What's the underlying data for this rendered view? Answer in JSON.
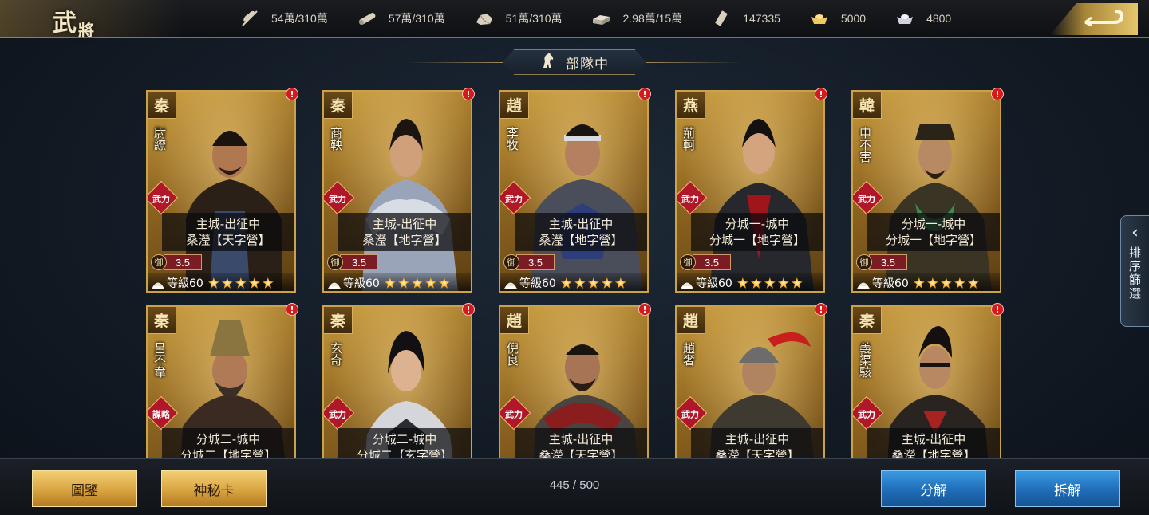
{
  "header": {
    "title_big": "武",
    "title_small": "將",
    "resources": [
      {
        "icon": "grain-icon",
        "value": "54萬/310萬"
      },
      {
        "icon": "wood-icon",
        "value": "57萬/310萬"
      },
      {
        "icon": "stone-icon",
        "value": "51萬/310萬"
      },
      {
        "icon": "iron-icon",
        "value": "2.98萬/15萬"
      },
      {
        "icon": "decree-icon",
        "value": "147335"
      },
      {
        "icon": "gold-ingot-icon",
        "value": "5000"
      },
      {
        "icon": "silver-ingot-icon",
        "value": "4800"
      }
    ]
  },
  "section": {
    "label": "部隊中"
  },
  "generals": [
    {
      "faction": "秦",
      "name": "尉繚",
      "role": "武力",
      "status1": "主城-出征中",
      "status2": "桑瀅【天字營】",
      "defense_label": "御",
      "defense": "3.5",
      "level": "等級60",
      "stars": 5
    },
    {
      "faction": "秦",
      "name": "商鞅",
      "role": "武力",
      "status1": "主城-出征中",
      "status2": "桑瀅【地字營】",
      "defense_label": "御",
      "defense": "3.5",
      "level": "等級60",
      "stars": 5
    },
    {
      "faction": "趙",
      "name": "李牧",
      "role": "武力",
      "status1": "主城-出征中",
      "status2": "桑瀅【地字營】",
      "defense_label": "御",
      "defense": "3.5",
      "level": "等級60",
      "stars": 5
    },
    {
      "faction": "燕",
      "name": "荊軻",
      "role": "武力",
      "status1": "分城一-城中",
      "status2": "分城一【地字營】",
      "defense_label": "御",
      "defense": "3.5",
      "level": "等級60",
      "stars": 5
    },
    {
      "faction": "韓",
      "name": "申不害",
      "role": "武力",
      "status1": "分城一-城中",
      "status2": "分城一【地字營】",
      "defense_label": "御",
      "defense": "3.5",
      "level": "等級60",
      "stars": 5
    },
    {
      "faction": "秦",
      "name": "呂不韋",
      "role": "謀略",
      "status1": "分城二-城中",
      "status2": "分城二【地字營】"
    },
    {
      "faction": "秦",
      "name": "玄奇",
      "role": "武力",
      "status1": "分城二-城中",
      "status2": "分城二【玄字營】"
    },
    {
      "faction": "趙",
      "name": "倪良",
      "role": "武力",
      "status1": "主城-出征中",
      "status2": "桑瀅【天字營】"
    },
    {
      "faction": "趙",
      "name": "趙奢",
      "role": "武力",
      "status1": "主城-出征中",
      "status2": "桑瀅【天字營】"
    },
    {
      "faction": "秦",
      "name": "義渠駭",
      "role": "武力",
      "status1": "主城-出征中",
      "status2": "桑瀅【地字營】"
    }
  ],
  "side_tab": {
    "label": "排序篩選"
  },
  "footer": {
    "catalog_label": "圖鑒",
    "mystery_card_label": "神秘卡",
    "count": "445 / 500",
    "decompose_label": "分解",
    "disassemble_label": "拆解"
  },
  "colors": {
    "gold": "#caa24c",
    "alert_red": "#d41a1a",
    "button_blue": "#1f6cb8",
    "button_gold": "#d9a440"
  }
}
